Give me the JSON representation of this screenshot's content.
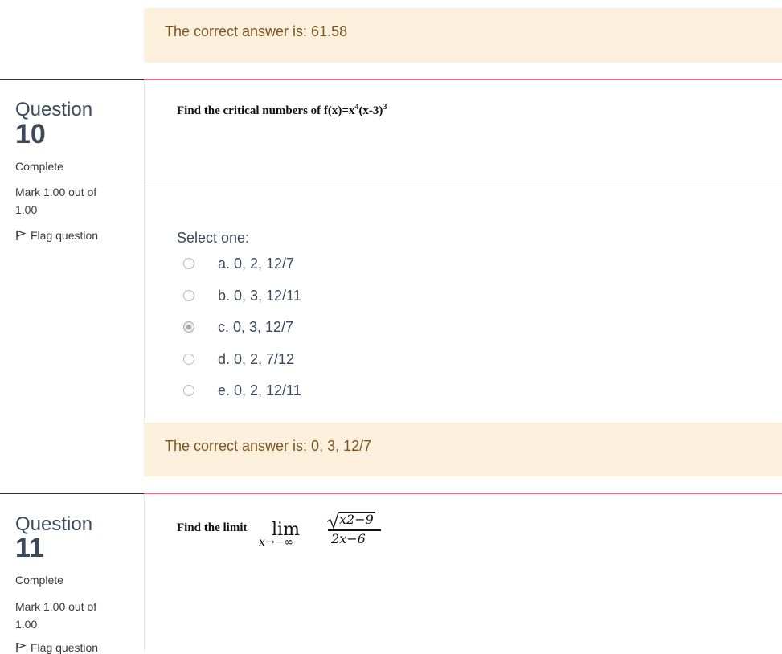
{
  "previous_feedback": {
    "text": "The correct answer is: 61.58"
  },
  "q10": {
    "label": "Question",
    "number": "10",
    "state": "Complete",
    "mark": "Mark 1.00 out of",
    "mark2": "1.00",
    "flag": "Flag question",
    "text_pre": "Find the critical numbers of f(x)=x",
    "exp1": "4",
    "text_mid": "(x-3)",
    "exp2": "3",
    "select_one": "Select one:",
    "options": [
      {
        "label": "a. 0, 2, 12/7",
        "checked": false
      },
      {
        "label": "b. 0, 3, 12/11",
        "checked": false
      },
      {
        "label": "c. 0, 3, 12/7",
        "checked": true
      },
      {
        "label": "d. 0, 2, 7/12",
        "checked": false
      },
      {
        "label": "e. 0, 2, 12/11",
        "checked": false
      }
    ],
    "feedback": "The correct answer is: 0, 3, 12/7"
  },
  "q11": {
    "label": "Question",
    "number": "11",
    "state": "Complete",
    "mark": "Mark 1.00 out of",
    "mark2": "1.00",
    "flag": "Flag question",
    "text": "Find the limit",
    "lim": "lim",
    "lim_sub": "x→−∞",
    "numerator": "x2−9",
    "denominator": "2x−6"
  },
  "colors": {
    "feedback_bg": "#fcefdc",
    "feedback_text": "#7a5522",
    "accent_rule": "#e8708a"
  }
}
